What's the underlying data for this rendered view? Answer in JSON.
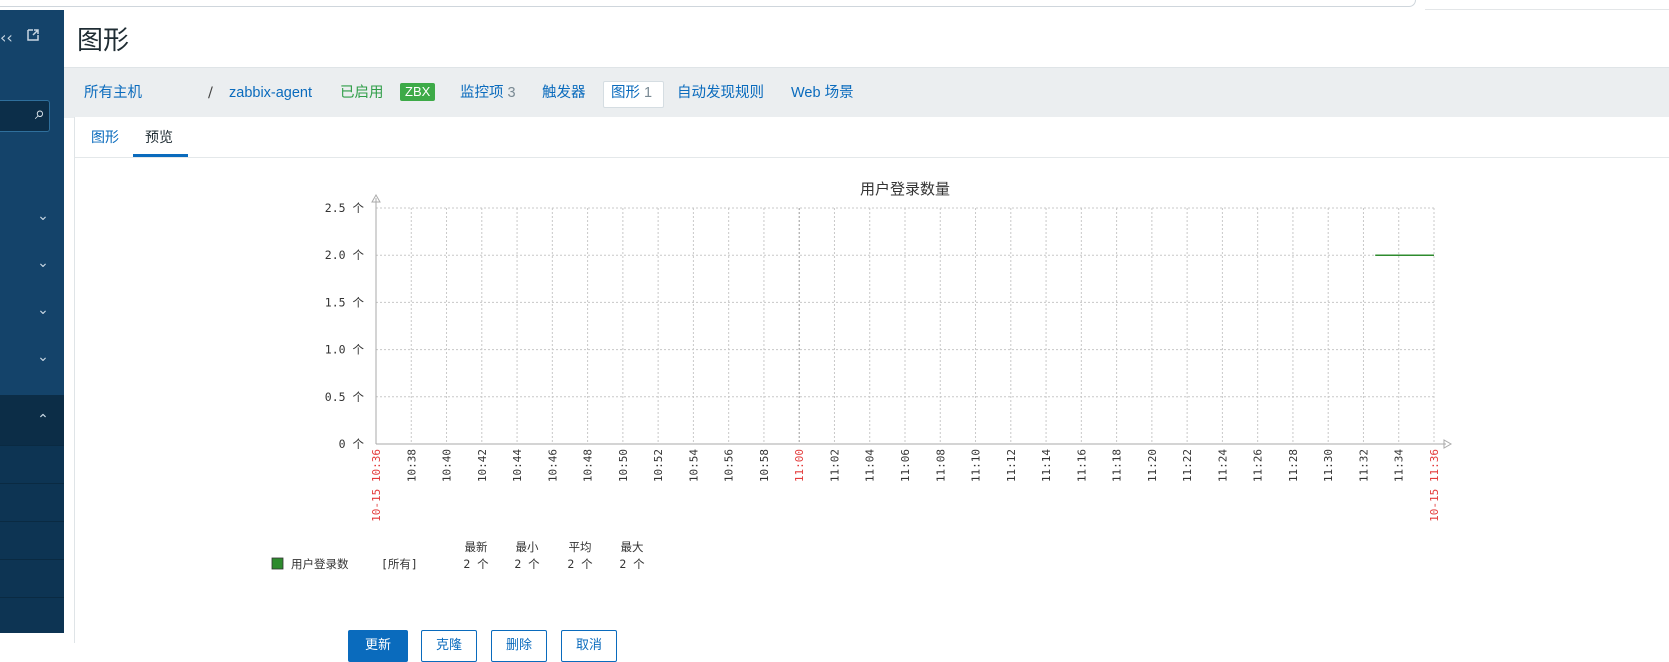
{
  "page": {
    "title": "图形"
  },
  "host_nav": {
    "all_hosts": "所有主机",
    "separator": "/",
    "host_name": "zabbix-agent",
    "status": "已启用",
    "badge": "ZBX",
    "items_label": "监控项",
    "items_count": "3",
    "triggers_label": "触发器",
    "graphs_label": "图形",
    "graphs_count": "1",
    "discovery_label": "自动发现规则",
    "web_label": "Web 场景"
  },
  "tabs": [
    {
      "label": "图形",
      "active": false
    },
    {
      "label": "预览",
      "active": true
    }
  ],
  "chart_data": {
    "type": "line",
    "title": "用户登录数量",
    "y_unit": "个",
    "ylim": [
      0,
      2.5
    ],
    "y_ticks": [
      "0 个",
      "0.5 个",
      "1.0 个",
      "1.5 个",
      "2.0 个",
      "2.5 个"
    ],
    "x_start_label": "10-15 10:36",
    "x_end_label": "10-15 11:36",
    "x_ticks": [
      "10:38",
      "10:40",
      "10:42",
      "10:44",
      "10:46",
      "10:48",
      "10:50",
      "10:52",
      "10:54",
      "10:56",
      "10:58",
      "11:00",
      "11:02",
      "11:04",
      "11:06",
      "11:08",
      "11:10",
      "11:12",
      "11:14",
      "11:16",
      "11:18",
      "11:20",
      "11:22",
      "11:24",
      "11:26",
      "11:28",
      "11:30",
      "11:32",
      "11:34"
    ],
    "x_highlight_tick": "11:00",
    "grid": true,
    "series": [
      {
        "name": "用户登录数",
        "color": "#2e8b2e",
        "points": [
          {
            "x": "11:32:40",
            "y": 2
          },
          {
            "x": "11:36",
            "y": 2
          }
        ]
      }
    ],
    "legend": {
      "headers": [
        "最新",
        "最小",
        "平均",
        "最大"
      ],
      "rows": [
        {
          "name": "用户登录数",
          "scope": "[所有]",
          "last": "2 个",
          "min": "2 个",
          "avg": "2 个",
          "max": "2 个"
        }
      ]
    }
  },
  "buttons": [
    "更新",
    "克隆",
    "删除",
    "取消"
  ],
  "colors": {
    "sidebar": "#14436a",
    "link": "#0a6bbd",
    "enabled": "#2f9e48",
    "time_label": "#e33b3b"
  }
}
